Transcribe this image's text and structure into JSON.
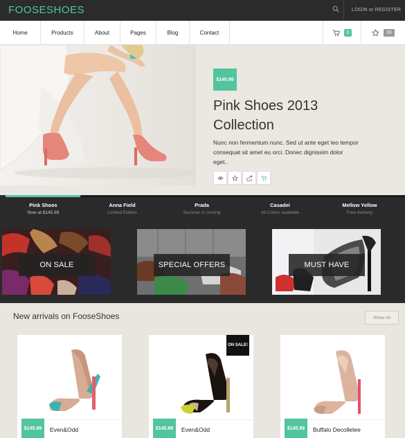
{
  "header": {
    "logo": "FOOSESHOES",
    "login_label": "LOGIN or REGISTER",
    "icons": {
      "search": "search-icon"
    }
  },
  "nav": {
    "items": [
      "Home",
      "Products",
      "About",
      "Pages",
      "Blog",
      "Contact"
    ],
    "cart_count": "0",
    "favorites_count": "30",
    "icons": {
      "cart": "cart-icon",
      "favorites": "star-icon"
    }
  },
  "hero": {
    "price": "$145.99",
    "title": "Pink Shoes 2013 Collection",
    "description": "Nunc non fermentum nunc. Sed ut ante eget leo tempor consequat sit amet eu orci. Donec dignissim dolor eget..",
    "actions": [
      "eye-icon",
      "star-icon",
      "share-icon",
      "cart-add-icon"
    ]
  },
  "slider_tabs": [
    {
      "title": "Pink Shoes",
      "subtitle": "Now at $145.99",
      "active": true
    },
    {
      "title": "Anna Field",
      "subtitle": "Limited Edition",
      "active": false
    },
    {
      "title": "Prada",
      "subtitle": "Summer is coming",
      "active": false
    },
    {
      "title": "Casadei",
      "subtitle": "All Colors available",
      "active": false
    },
    {
      "title": "Mellow Yellow",
      "subtitle": "Free delivery",
      "active": false
    }
  ],
  "categories": [
    {
      "label": "ON SALE"
    },
    {
      "label": "SPECIAL OFFERS"
    },
    {
      "label": "MUST HAVE"
    }
  ],
  "arrivals": {
    "title": "New arrivals on FooseShoes",
    "show_all": "Show All",
    "products": [
      {
        "price": "$145.99",
        "name": "Even&Odd",
        "badge": ""
      },
      {
        "price": "$145.99",
        "name": "Even&Odd",
        "badge": "ON SALE!"
      },
      {
        "price": "$145.99",
        "name": "Buffalo Decolletee",
        "badge": ""
      }
    ]
  },
  "colors": {
    "accent": "#52c49e",
    "dark": "#2a2a2a",
    "background": "#e9e5df"
  }
}
